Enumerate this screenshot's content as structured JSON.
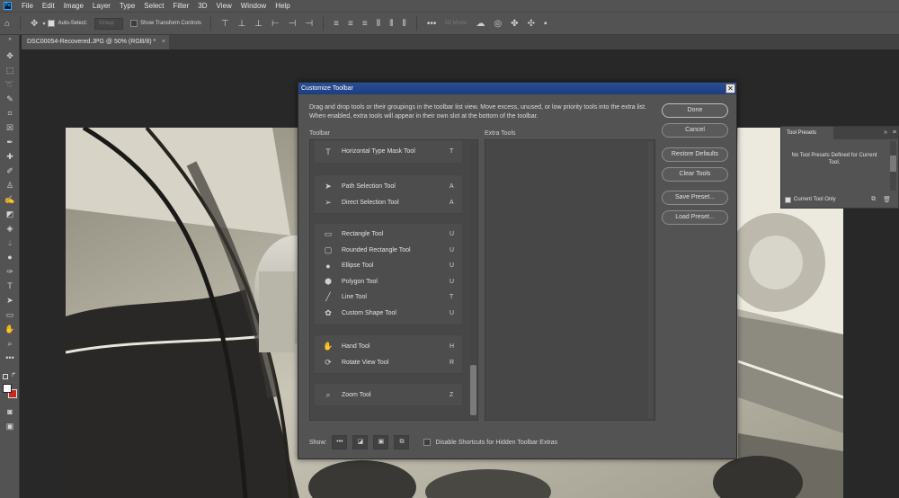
{
  "menubar": {
    "logo": "Ps",
    "items": [
      "File",
      "Edit",
      "Image",
      "Layer",
      "Type",
      "Select",
      "Filter",
      "3D",
      "View",
      "Window",
      "Help"
    ]
  },
  "options": {
    "auto_select": "Auto-Select:",
    "group": "Group",
    "show_transform": "Show Transform Controls",
    "mode_3d": "3D Mode:"
  },
  "document": {
    "tab_title": "DSC00054-Recovered.JPG @ 50% (RGB/8) *",
    "close": "×"
  },
  "dialog": {
    "title": "Customize Toolbar",
    "close": "✕",
    "description": "Drag and drop tools or their groupings in the toolbar list view. Move excess, unused, or low priority tools into the extra list. When enabled, extra tools will appear in their own slot at the bottom of the toolbar.",
    "toolbar_label": "Toolbar",
    "extra_label": "Extra Tools",
    "groups": [
      {
        "tools": [
          {
            "icon": "type-mask-icon",
            "glyph": "T",
            "name": "Horizontal Type Mask Tool",
            "shortcut": "T"
          }
        ]
      },
      {
        "tools": [
          {
            "icon": "path-selection-icon",
            "glyph": "➤",
            "name": "Path Selection Tool",
            "shortcut": "A"
          },
          {
            "icon": "direct-selection-icon",
            "glyph": "➢",
            "name": "Direct Selection Tool",
            "shortcut": "A"
          }
        ]
      },
      {
        "tools": [
          {
            "icon": "rectangle-icon",
            "glyph": "▭",
            "name": "Rectangle Tool",
            "shortcut": "U"
          },
          {
            "icon": "rounded-rectangle-icon",
            "glyph": "▢",
            "name": "Rounded Rectangle Tool",
            "shortcut": "U"
          },
          {
            "icon": "ellipse-icon",
            "glyph": "●",
            "name": "Ellipse Tool",
            "shortcut": "U"
          },
          {
            "icon": "polygon-icon",
            "glyph": "⬢",
            "name": "Polygon Tool",
            "shortcut": "U"
          },
          {
            "icon": "line-icon",
            "glyph": "╱",
            "name": "Line Tool",
            "shortcut": "T"
          },
          {
            "icon": "custom-shape-icon",
            "glyph": "✿",
            "name": "Custom Shape Tool",
            "shortcut": "U"
          }
        ]
      },
      {
        "tools": [
          {
            "icon": "hand-icon",
            "glyph": "✋",
            "name": "Hand Tool",
            "shortcut": "H"
          },
          {
            "icon": "rotate-view-icon",
            "glyph": "⟳",
            "name": "Rotate View Tool",
            "shortcut": "R"
          }
        ]
      },
      {
        "tools": [
          {
            "icon": "zoom-icon",
            "glyph": "⌕",
            "name": "Zoom Tool",
            "shortcut": "Z"
          }
        ]
      }
    ],
    "buttons": {
      "done": "Done",
      "cancel": "Cancel",
      "restore": "Restore Defaults",
      "clear": "Clear Tools",
      "save_preset": "Save Preset...",
      "load_preset": "Load Preset..."
    },
    "show_label": "Show:",
    "show_icons": [
      "•••",
      "◪",
      "▣",
      "⧉"
    ],
    "disable_shortcuts": "Disable Shortcuts for Hidden Toolbar Extras"
  },
  "presets": {
    "title": "Tool Presets",
    "arrows": "»",
    "menu": "≡",
    "message": "No Tool Presets Defined for Current Tool.",
    "current_only": "Current Tool Only"
  },
  "colors": {
    "titlebar": "#1d3d7d",
    "panel": "#535353",
    "background": "#282828",
    "foreground_swatch": "#ffffff",
    "background_swatch": "#c8281e"
  }
}
